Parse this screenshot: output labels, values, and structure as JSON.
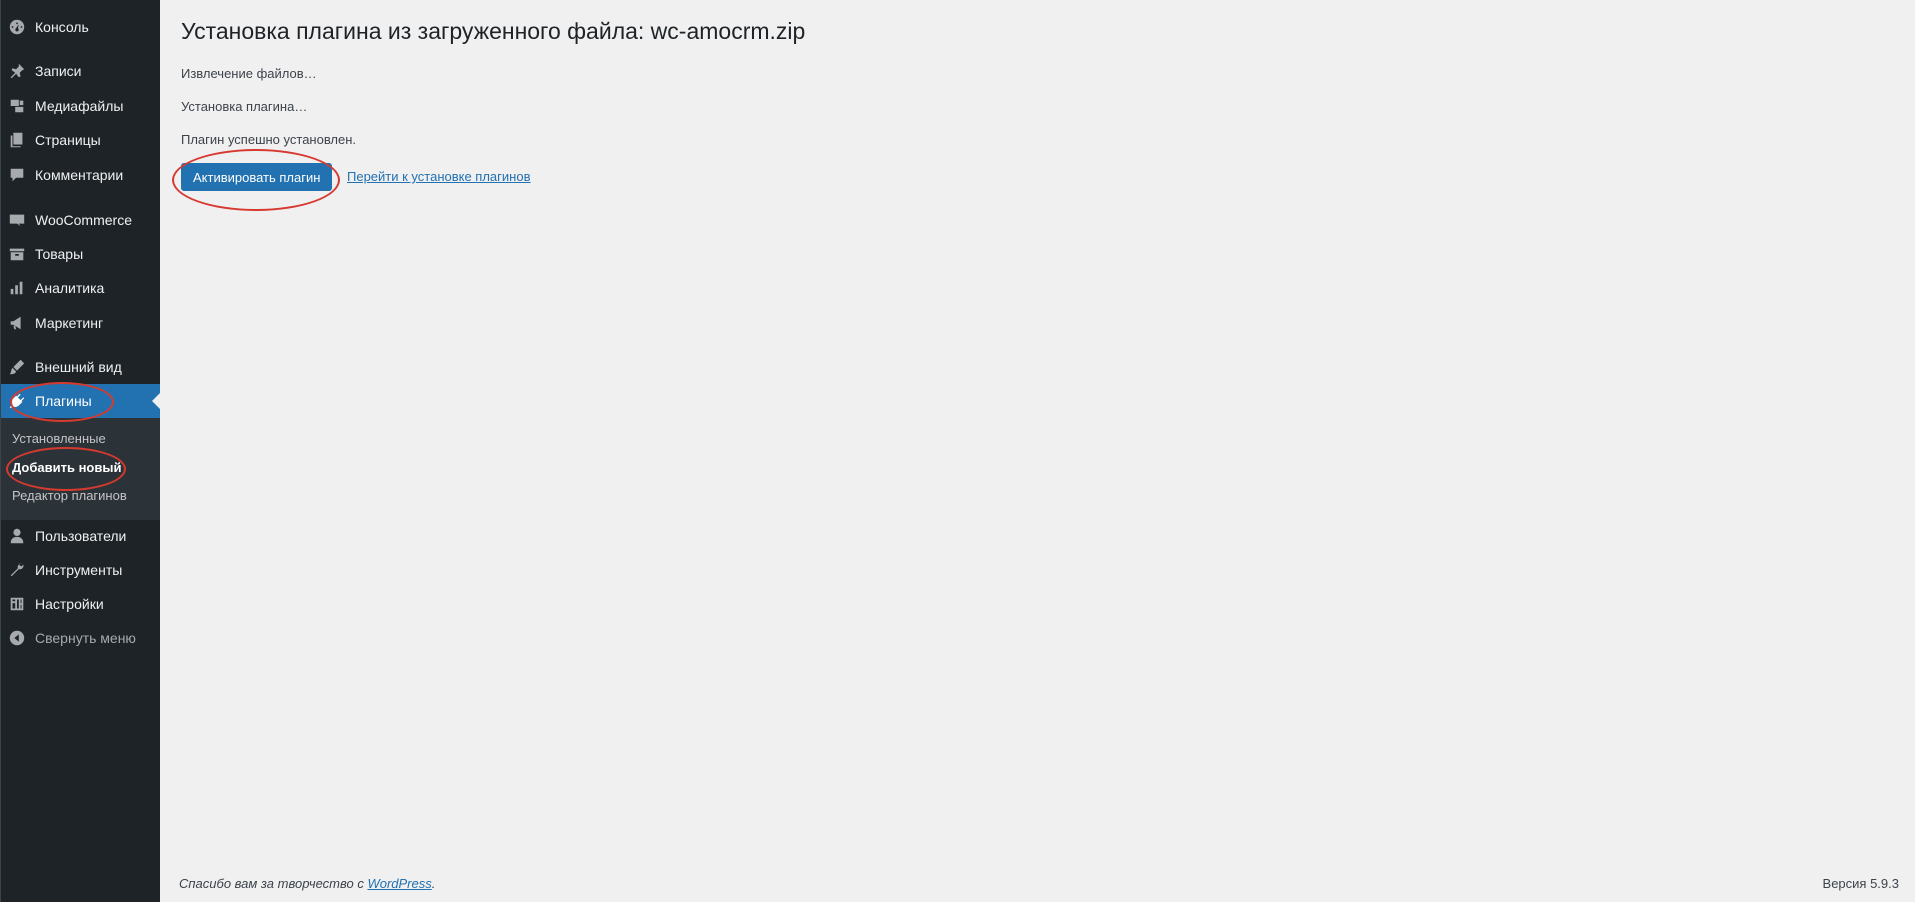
{
  "sidebar": {
    "items": [
      {
        "label": "Консоль",
        "icon": "dashboard-icon"
      },
      {
        "label": "Записи",
        "icon": "pin-icon"
      },
      {
        "label": "Медиафайлы",
        "icon": "media-icon"
      },
      {
        "label": "Страницы",
        "icon": "pages-icon"
      },
      {
        "label": "Комментарии",
        "icon": "comments-icon"
      },
      {
        "label": "WooCommerce",
        "icon": "woocommerce-icon"
      },
      {
        "label": "Товары",
        "icon": "products-icon"
      },
      {
        "label": "Аналитика",
        "icon": "analytics-icon"
      },
      {
        "label": "Маркетинг",
        "icon": "megaphone-icon"
      },
      {
        "label": "Внешний вид",
        "icon": "brush-icon"
      },
      {
        "label": "Плагины",
        "icon": "plugin-icon",
        "active": true
      },
      {
        "label": "Пользователи",
        "icon": "users-icon"
      },
      {
        "label": "Инструменты",
        "icon": "wrench-icon"
      },
      {
        "label": "Настройки",
        "icon": "settings-icon"
      },
      {
        "label": "Свернуть меню",
        "icon": "collapse-icon"
      }
    ],
    "submenu": [
      {
        "label": "Установленные"
      },
      {
        "label": "Добавить новый",
        "current": true
      },
      {
        "label": "Редактор плагинов"
      }
    ]
  },
  "main": {
    "title": "Установка плагина из загруженного файла: wc-amocrm.zip",
    "log": [
      "Извлечение файлов…",
      "Установка плагина…",
      "Плагин успешно установлен."
    ],
    "activate_button": "Активировать плагин",
    "back_link": "Перейти к установке плагинов"
  },
  "footer": {
    "thanks_prefix": "Спасибо вам за творчество с ",
    "thanks_link": "WordPress",
    "thanks_suffix": ".",
    "version": "Версия 5.9.3"
  },
  "colors": {
    "sidebar_bg": "#1d2327",
    "accent": "#2271b1",
    "annotation": "#d63a2f",
    "page_bg": "#f0f0f1"
  }
}
